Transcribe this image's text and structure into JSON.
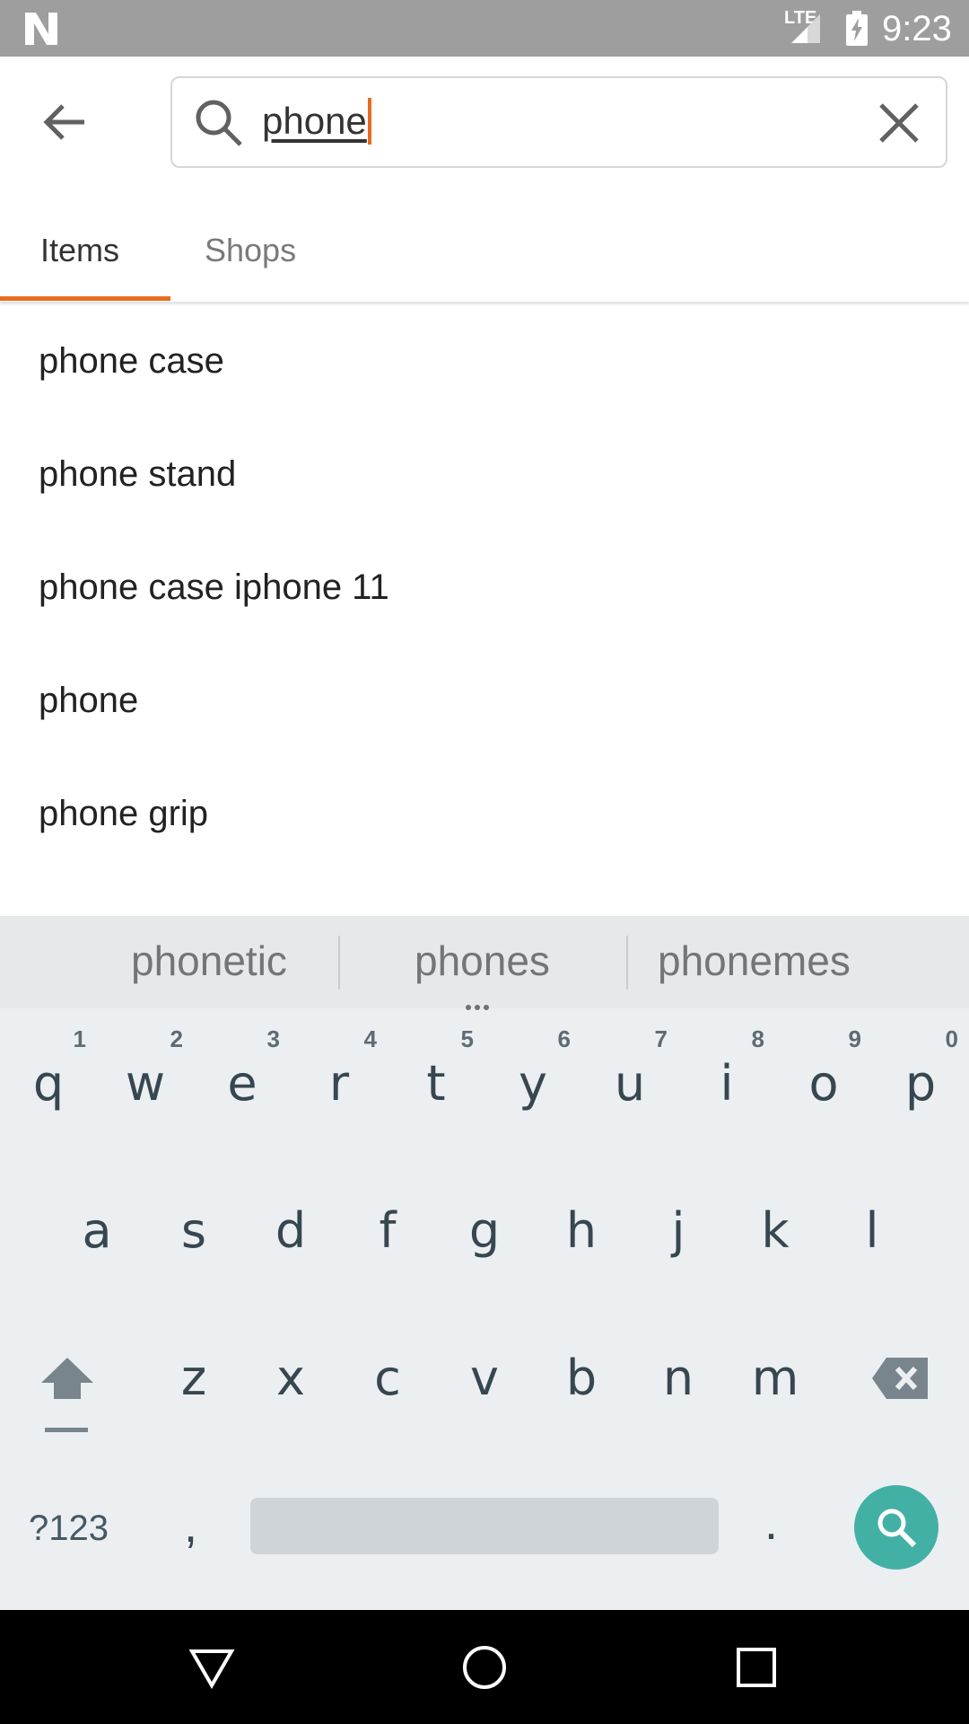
{
  "status_bar": {
    "time": "9:23",
    "network": "LTE",
    "icons": [
      "n-logo-icon",
      "signal-icon",
      "battery-charging-icon"
    ]
  },
  "search": {
    "query": "phone",
    "icons": [
      "back-arrow-icon",
      "search-icon",
      "clear-icon"
    ]
  },
  "tabs": [
    {
      "label": "Items",
      "active": true
    },
    {
      "label": "Shops",
      "active": false
    }
  ],
  "suggestions": [
    "phone case",
    "phone stand",
    "phone case iphone 11",
    "phone",
    "phone grip"
  ],
  "keyboard": {
    "suggestions": [
      "phonetic",
      "phones",
      "phonemes"
    ],
    "row1": [
      {
        "key": "q",
        "num": "1"
      },
      {
        "key": "w",
        "num": "2"
      },
      {
        "key": "e",
        "num": "3"
      },
      {
        "key": "r",
        "num": "4"
      },
      {
        "key": "t",
        "num": "5"
      },
      {
        "key": "y",
        "num": "6"
      },
      {
        "key": "u",
        "num": "7"
      },
      {
        "key": "i",
        "num": "8"
      },
      {
        "key": "o",
        "num": "9"
      },
      {
        "key": "p",
        "num": "0"
      }
    ],
    "row2": [
      "a",
      "s",
      "d",
      "f",
      "g",
      "h",
      "j",
      "k",
      "l"
    ],
    "row3": [
      "z",
      "x",
      "c",
      "v",
      "b",
      "n",
      "m"
    ],
    "symbols_label": "?123",
    "comma": ",",
    "period": ".",
    "icons": [
      "shift-icon",
      "backspace-icon",
      "search-action-icon"
    ]
  },
  "colors": {
    "accent": "#e66d1f",
    "status_bar": "#9e9e9e",
    "keyboard_bg": "#eceff1",
    "search_key": "#26a69a"
  },
  "nav_bar": {
    "icons": [
      "back-triangle-icon",
      "home-circle-icon",
      "recents-square-icon"
    ]
  }
}
